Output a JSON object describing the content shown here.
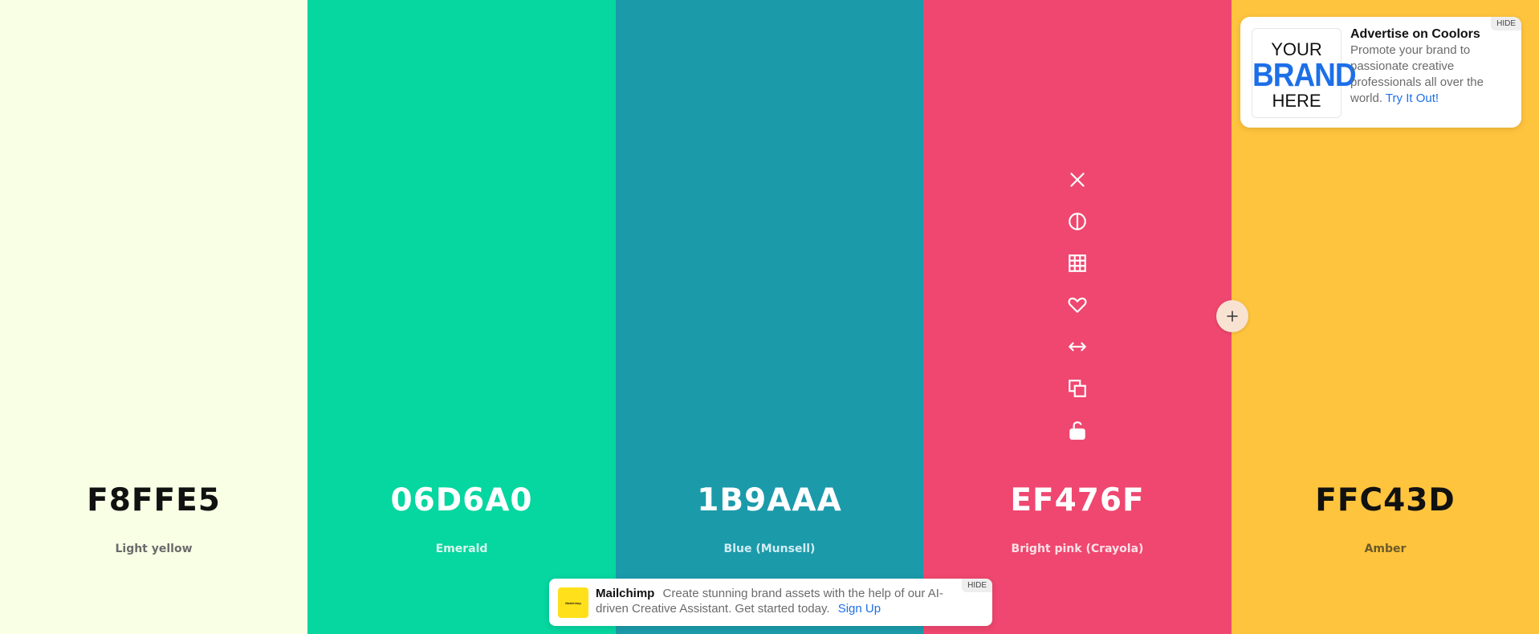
{
  "swatches": [
    {
      "hex": "F8FFE5",
      "name": "Light yellow",
      "bg": "#F8FFE5",
      "text_color": "#111111",
      "name_color": "#6b6b6b"
    },
    {
      "hex": "06D6A0",
      "name": "Emerald",
      "bg": "#06D6A0",
      "text_color": "#FFFFFF",
      "name_color": "#d9f7ec"
    },
    {
      "hex": "1B9AAA",
      "name": "Blue (Munsell)",
      "bg": "#1B9AAA",
      "text_color": "#FFFFFF",
      "name_color": "#d2ecf0"
    },
    {
      "hex": "EF476F",
      "name": "Bright pink (Crayola)",
      "bg": "#EF476F",
      "text_color": "#FFFFFF",
      "name_color": "#fde0e7"
    },
    {
      "hex": "FFC43D",
      "name": "Amber",
      "bg": "#FFC43D",
      "text_color": "#111111",
      "name_color": "#6b5a2a"
    }
  ],
  "tools": [
    "close-icon",
    "contrast-icon",
    "grid-icon",
    "heart-icon",
    "drag-arrows-icon",
    "copy-icon",
    "unlock-icon"
  ],
  "ad": {
    "logo_line1": "YOUR",
    "logo_line2": "BRAND",
    "logo_line3": "HERE",
    "title": "Advertise on Coolors",
    "body": "Promote your brand to passionate creative professionals all over the world.",
    "cta": "Try It Out!",
    "hide_label": "HIDE"
  },
  "mailchimp": {
    "logo_text": "Mailchimp",
    "title": "Mailchimp",
    "body": "Create stunning brand assets with the help of our AI-driven Creative Assistant. Get started today.",
    "cta": "Sign Up",
    "hide_label": "HIDE"
  }
}
